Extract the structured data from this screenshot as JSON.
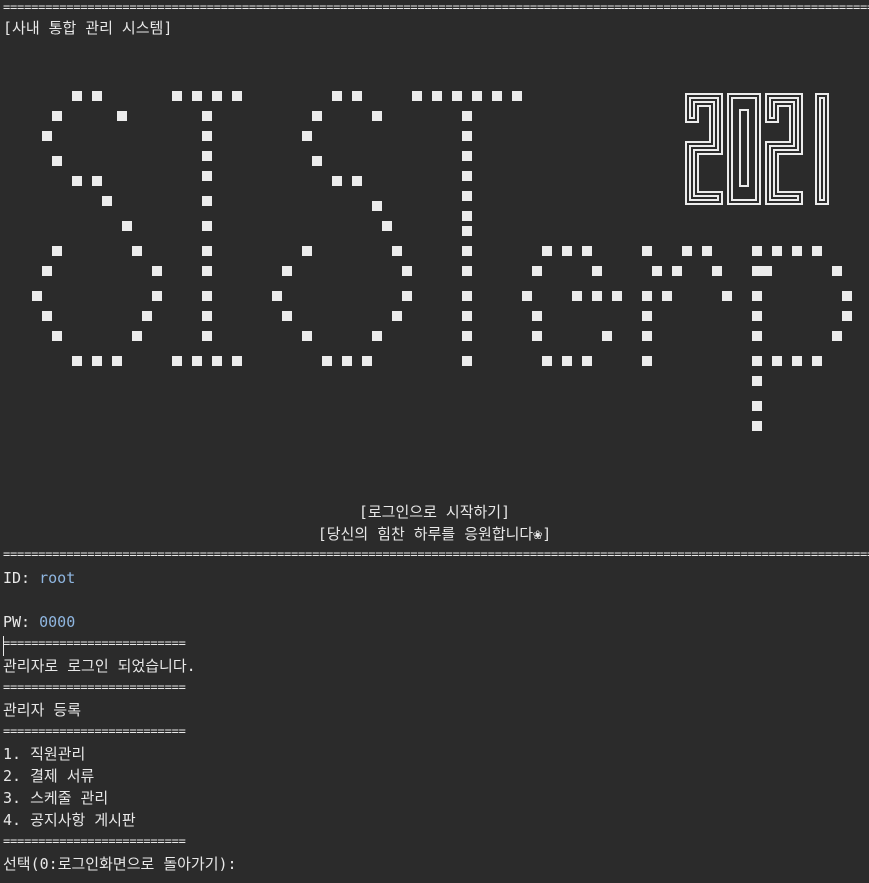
{
  "header": {
    "rule": "================================================================================================================================",
    "title": "[사내 통합 관리 시스템]"
  },
  "banner": {
    "art_text": "SIST erp",
    "year": "2021",
    "start_label": "[로그인으로 시작하기]",
    "cheer_label": "[당신의 힘찬 하루를 응원합니다❀]"
  },
  "login": {
    "id_label": "ID:",
    "id_value": "root",
    "pw_label": "PW:",
    "pw_value": "0000"
  },
  "messages": {
    "short_rule": "==========================",
    "login_success": "관리자로 로그인 되었습니다.",
    "section_title": "관리자 등록"
  },
  "menu": {
    "items": [
      {
        "num": "1.",
        "label": "직원관리"
      },
      {
        "num": "2.",
        "label": "결제 서류"
      },
      {
        "num": "3.",
        "label": "스케줄 관리"
      },
      {
        "num": "4.",
        "label": "공지사항 게시판"
      }
    ],
    "prompt": "선택(0:로그인화면으로 돌아가기):"
  }
}
